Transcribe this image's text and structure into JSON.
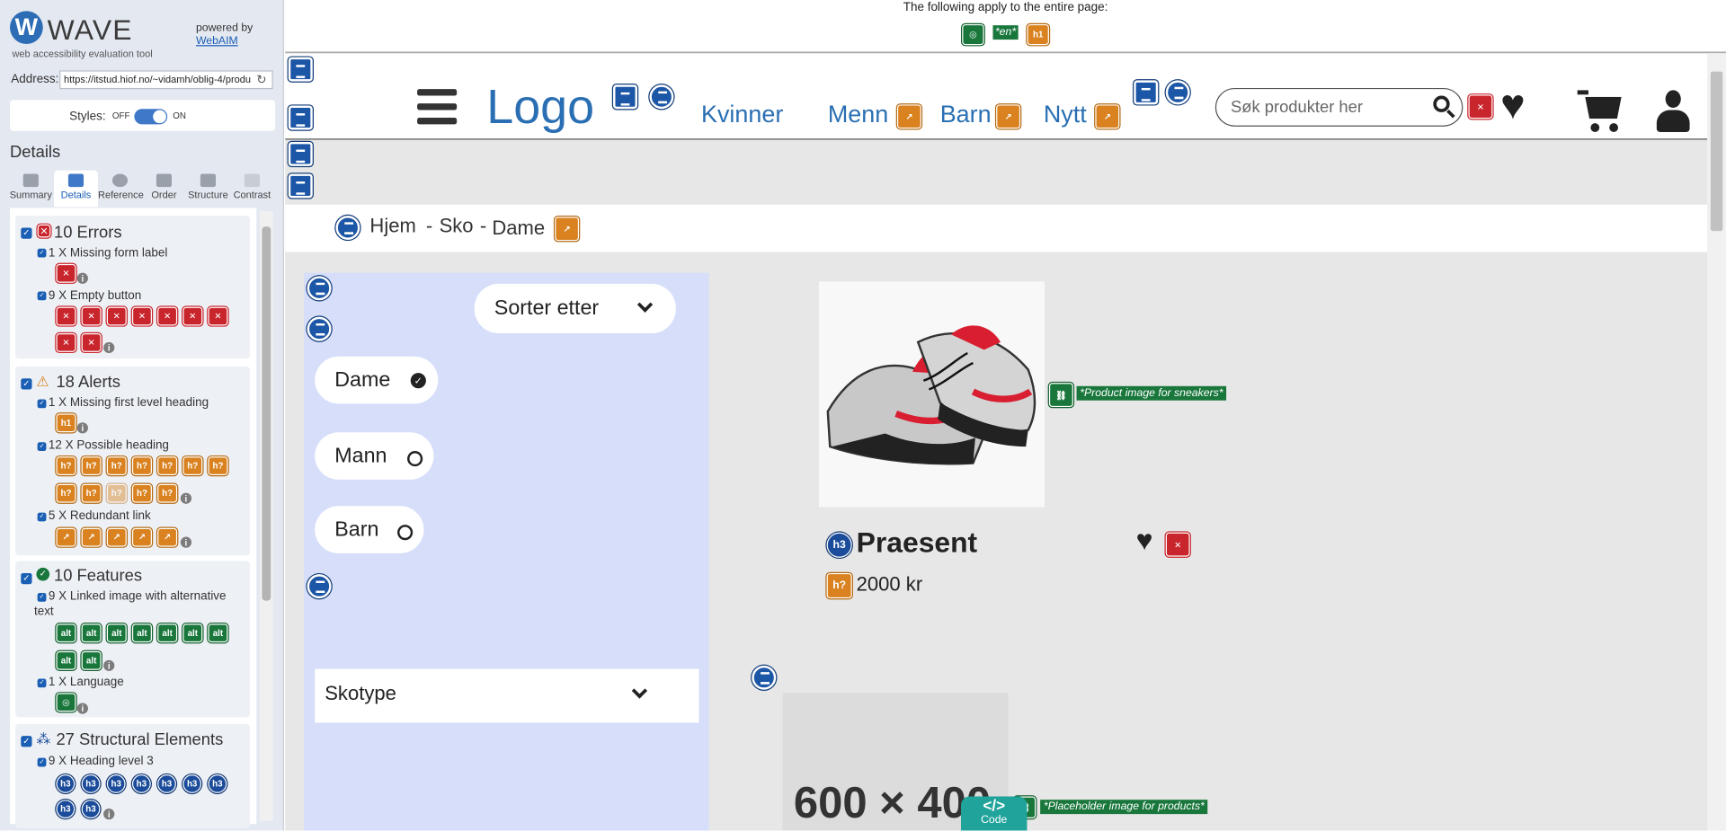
{
  "wave": {
    "logo_text": "WAVE",
    "tagline": "web accessibility evaluation tool",
    "powered_by": "powered by",
    "webaim_link": "WebAIM",
    "address_label": "Address:",
    "address_value": "https://itstud.hiof.no/~vidamh/oblig-4/produ",
    "styles_label": "Styles:",
    "styles_off": "OFF",
    "styles_on": "ON",
    "details_heading": "Details",
    "tabs": [
      {
        "label": "Summary"
      },
      {
        "label": "Details"
      },
      {
        "label": "Reference"
      },
      {
        "label": "Order"
      },
      {
        "label": "Structure"
      },
      {
        "label": "Contrast"
      }
    ],
    "errors": {
      "title": "10 Errors",
      "items": [
        {
          "label": "1 X Missing form label"
        },
        {
          "label": "9 X Empty button"
        }
      ]
    },
    "alerts": {
      "title": "18 Alerts",
      "items": [
        {
          "label": "1 X Missing first level heading"
        },
        {
          "label": "12 X Possible heading"
        },
        {
          "label": "5 X Redundant link"
        }
      ]
    },
    "features": {
      "title": "10 Features",
      "items": [
        {
          "label": "9 X Linked image with alternative"
        },
        {
          "label": "text"
        },
        {
          "label": "1 X Language"
        }
      ]
    },
    "structural": {
      "title": "27 Structural Elements",
      "items": [
        {
          "label": "9 X Heading level 3"
        }
      ]
    },
    "icons": {
      "error": "error-icon",
      "alert": "alert-icon",
      "feature": "feature-icon",
      "info": "info-icon",
      "refresh": "refresh-icon"
    }
  },
  "banner": {
    "text": "The following apply to the entire page:",
    "lang_badge": "*en*",
    "h1_badge": "h1"
  },
  "site": {
    "logo": "Logo",
    "nav": [
      {
        "label": "Kvinner"
      },
      {
        "label": "Menn"
      },
      {
        "label": "Barn"
      },
      {
        "label": "Nytt"
      }
    ],
    "search_placeholder": "Søk produkter her",
    "breadcrumb": {
      "home": "Hjem",
      "sep": "-",
      "shoes": "Sko",
      "current": "Dame"
    },
    "sort_label": "Sorter etter",
    "filters": [
      {
        "label": "Dame",
        "checked": true
      },
      {
        "label": "Mann",
        "checked": false
      },
      {
        "label": "Barn",
        "checked": false
      }
    ],
    "shoetype_label": "Skotype",
    "product": {
      "name": "Praesent",
      "price": "2000 kr",
      "h3_badge": "h3",
      "h_badge": "h?",
      "image_alt": "*Product image for sneakers*"
    },
    "placeholder": {
      "text": "600 × 400",
      "alt": "*Placeholder image for products*"
    },
    "code_button": "Code",
    "code_glyph": "</>"
  },
  "colors": {
    "brand": "#2a6fb3",
    "error": "#c9252c",
    "alert": "#d9821f",
    "feature": "#19773c",
    "structure": "#1b4c9b",
    "filter_panel": "#d6defa"
  }
}
